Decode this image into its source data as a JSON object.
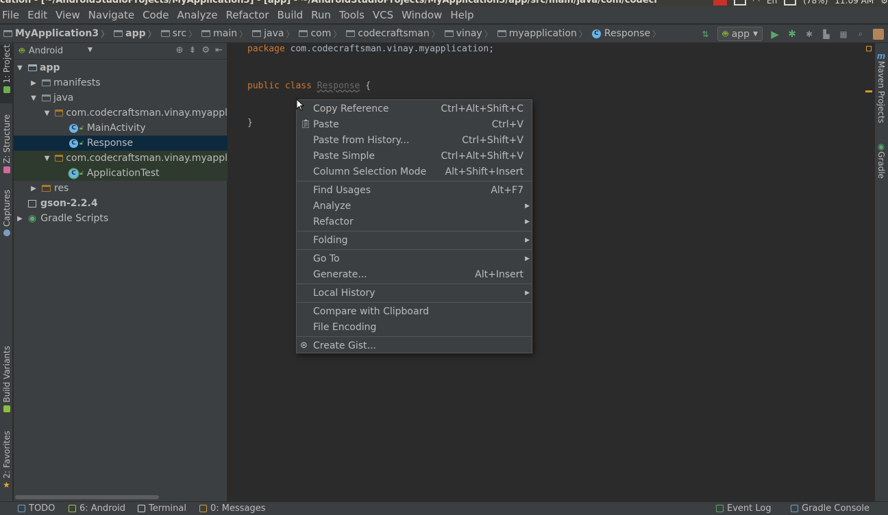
{
  "window": {
    "title": "cation - [~/AndroidStudioProjects/MyApplication3] - [app] - ~/AndroidStudioProjects/MyApplication3/app/src/main/java/com/codecr",
    "tray_time": "11:09 AM",
    "tray_battery": "(78%)",
    "tray_lang": "En"
  },
  "menubar": [
    {
      "label": "File",
      "name": "menu-file"
    },
    {
      "label": "Edit",
      "name": "menu-edit"
    },
    {
      "label": "View",
      "name": "menu-view"
    },
    {
      "label": "Navigate",
      "name": "menu-navigate"
    },
    {
      "label": "Code",
      "name": "menu-code"
    },
    {
      "label": "Analyze",
      "name": "menu-analyze"
    },
    {
      "label": "Refactor",
      "name": "menu-refactor"
    },
    {
      "label": "Build",
      "name": "menu-build"
    },
    {
      "label": "Run",
      "name": "menu-run"
    },
    {
      "label": "Tools",
      "name": "menu-tools"
    },
    {
      "label": "VCS",
      "name": "menu-vcs"
    },
    {
      "label": "Window",
      "name": "menu-window"
    },
    {
      "label": "Help",
      "name": "menu-help"
    }
  ],
  "breadcrumbs": [
    {
      "label": "MyApplication3",
      "icon": "project-folder",
      "bold": true
    },
    {
      "label": "app",
      "icon": "module-folder",
      "bold": true
    },
    {
      "label": "src",
      "icon": "folder"
    },
    {
      "label": "main",
      "icon": "folder"
    },
    {
      "label": "java",
      "icon": "folder"
    },
    {
      "label": "com",
      "icon": "folder"
    },
    {
      "label": "codecraftsman",
      "icon": "folder"
    },
    {
      "label": "vinay",
      "icon": "folder"
    },
    {
      "label": "myapplication",
      "icon": "folder"
    },
    {
      "label": "Response",
      "icon": "class"
    }
  ],
  "run_config": {
    "label": "app"
  },
  "left_tabs": {
    "project": "1: Project",
    "structure": "Z: Structure",
    "captures": "Captures",
    "build_variants": "Build Variants",
    "favorites": "2: Favorites"
  },
  "right_tabs": {
    "maven": "Maven Projects",
    "gradle": "Gradle"
  },
  "project_panel": {
    "view_mode": "Android",
    "tree": [
      {
        "label": "app",
        "level": 0,
        "arrow": "down",
        "icon": "module",
        "bold": true,
        "state": ""
      },
      {
        "label": "manifests",
        "level": 1,
        "arrow": "right",
        "icon": "folder",
        "state": ""
      },
      {
        "label": "java",
        "level": 1,
        "arrow": "down",
        "icon": "folder",
        "state": ""
      },
      {
        "label": "com.codecraftsman.vinay.myappl",
        "level": 2,
        "arrow": "down",
        "icon": "package",
        "state": ""
      },
      {
        "label": "MainActivity",
        "level": 3,
        "arrow": "",
        "icon": "class",
        "state": ""
      },
      {
        "label": "Response",
        "level": 3,
        "arrow": "",
        "icon": "class",
        "state": "selected"
      },
      {
        "label": "com.codecraftsman.vinay.myappl",
        "level": 2,
        "arrow": "down",
        "icon": "package",
        "state": "test"
      },
      {
        "label": "ApplicationTest",
        "level": 3,
        "arrow": "",
        "icon": "test-class",
        "state": "test"
      },
      {
        "label": "res",
        "level": 1,
        "arrow": "right",
        "icon": "res",
        "state": ""
      },
      {
        "label": "gson-2.2.4",
        "level": 0,
        "arrow": "",
        "icon": "library",
        "bold": true,
        "state": ""
      },
      {
        "label": "Gradle Scripts",
        "level": 0,
        "arrow": "right",
        "icon": "gradle",
        "state": ""
      }
    ]
  },
  "editor": {
    "line1_kw": "package",
    "line1_rest": " com.codecraftsman.vinay.myapplication;",
    "line2_kw1": "public",
    "line2_kw2": "class",
    "line2_cls": "Response",
    "line2_rest": " {",
    "line3": "}"
  },
  "context_menu": {
    "groups": [
      [
        {
          "label": "Copy Reference",
          "shortcut": "Ctrl+Alt+Shift+C",
          "submenu": false,
          "icon": ""
        },
        {
          "label": "Paste",
          "shortcut": "Ctrl+V",
          "submenu": false,
          "icon": "paste-icon"
        },
        {
          "label": "Paste from History...",
          "shortcut": "Ctrl+Shift+V",
          "submenu": false,
          "icon": ""
        },
        {
          "label": "Paste Simple",
          "shortcut": "Ctrl+Alt+Shift+V",
          "submenu": false,
          "icon": ""
        },
        {
          "label": "Column Selection Mode",
          "shortcut": "Alt+Shift+Insert",
          "submenu": false,
          "icon": ""
        }
      ],
      [
        {
          "label": "Find Usages",
          "shortcut": "Alt+F7",
          "submenu": false,
          "icon": ""
        },
        {
          "label": "Analyze",
          "shortcut": "",
          "submenu": true,
          "icon": ""
        },
        {
          "label": "Refactor",
          "shortcut": "",
          "submenu": true,
          "icon": ""
        }
      ],
      [
        {
          "label": "Folding",
          "shortcut": "",
          "submenu": true,
          "icon": ""
        }
      ],
      [
        {
          "label": "Go To",
          "shortcut": "",
          "submenu": true,
          "icon": ""
        },
        {
          "label": "Generate...",
          "shortcut": "Alt+Insert",
          "submenu": false,
          "icon": ""
        }
      ],
      [
        {
          "label": "Local History",
          "shortcut": "",
          "submenu": true,
          "icon": ""
        }
      ],
      [
        {
          "label": "Compare with Clipboard",
          "shortcut": "",
          "submenu": false,
          "icon": ""
        },
        {
          "label": "File Encoding",
          "shortcut": "",
          "submenu": false,
          "icon": ""
        }
      ],
      [
        {
          "label": "Create Gist...",
          "shortcut": "",
          "submenu": false,
          "icon": "github-icon"
        }
      ]
    ]
  },
  "statusbar": [
    {
      "label": "TODO",
      "name": "todo-tab",
      "icon": "todo-icon"
    },
    {
      "label": "6: Android",
      "name": "android-tab",
      "icon": "android-icon"
    },
    {
      "label": "Terminal",
      "name": "terminal-tab",
      "icon": "terminal-icon"
    },
    {
      "label": "0: Messages",
      "name": "messages-tab",
      "icon": "messages-icon"
    },
    {
      "label": "Event Log",
      "name": "event-log-tab",
      "icon": "event-log-icon"
    },
    {
      "label": "Gradle Console",
      "name": "gradle-console-tab",
      "icon": "gradle-console-icon"
    }
  ],
  "colors": {
    "keyword": "#cc7832",
    "selection": "#0d293e",
    "panel": "#3c3f41",
    "editor_bg": "#2b2b2b"
  }
}
